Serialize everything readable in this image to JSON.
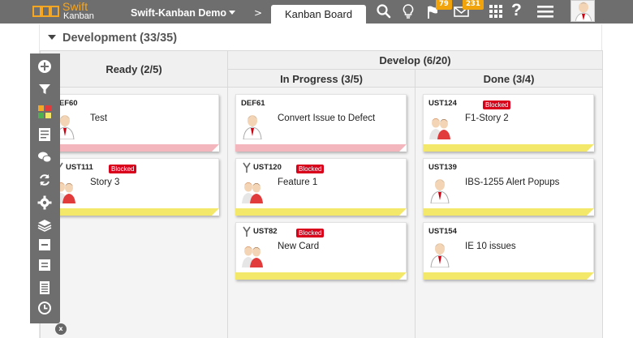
{
  "header": {
    "logo_line1": "Swift",
    "logo_line2": "Kanban",
    "project": "Swift-Kanban Demo",
    "breadcrumb_sep": ">",
    "view_tab": "Kanban Board",
    "notifications_count": "79",
    "messages_count": "231",
    "help_label": "?"
  },
  "lane": {
    "title": "Development (33/35)"
  },
  "columns": {
    "ready": "Ready (2/5)",
    "develop": "Develop (6/20)",
    "in_progress": "In Progress (3/5)",
    "done": "Done (3/4)"
  },
  "blocked_label": "Blocked",
  "cards": {
    "def60": {
      "id": "DEF60",
      "title": "Test",
      "strip": "pink"
    },
    "ust111": {
      "id": "UST111",
      "title": "Story 3",
      "blocked": true,
      "strip": "yellow"
    },
    "def61": {
      "id": "DEF61",
      "title": "Convert Issue to Defect",
      "strip": "pink"
    },
    "ust120": {
      "id": "UST120",
      "title": "Feature 1",
      "blocked": true,
      "strip": "yellow"
    },
    "ust82": {
      "id": "UST82",
      "title": "New Card",
      "blocked": true,
      "strip": "yellow"
    },
    "ust124": {
      "id": "UST124",
      "title": "F1-Story 2",
      "blocked": true,
      "strip": "yellow"
    },
    "ust139": {
      "id": "UST139",
      "title": "IBS-1255 Alert Popups",
      "strip": "yellow"
    },
    "ust154": {
      "id": "UST154",
      "title": "IE 10 issues",
      "strip": "yellow"
    }
  },
  "colors": {
    "topbar": "#6e6e6e",
    "accent": "#f0a30a",
    "blocked": "#d9001b",
    "strip_pink": "#f4b6bd",
    "strip_yellow": "#f4e86b"
  },
  "rail_icons": [
    "add-icon",
    "filter-icon",
    "color-legend-icon",
    "list-icon",
    "chat-icon",
    "sync-icon",
    "settings-icon",
    "layers-icon",
    "collapse-icon",
    "compact-icon",
    "document-icon",
    "history-icon"
  ],
  "rail_close": "x"
}
